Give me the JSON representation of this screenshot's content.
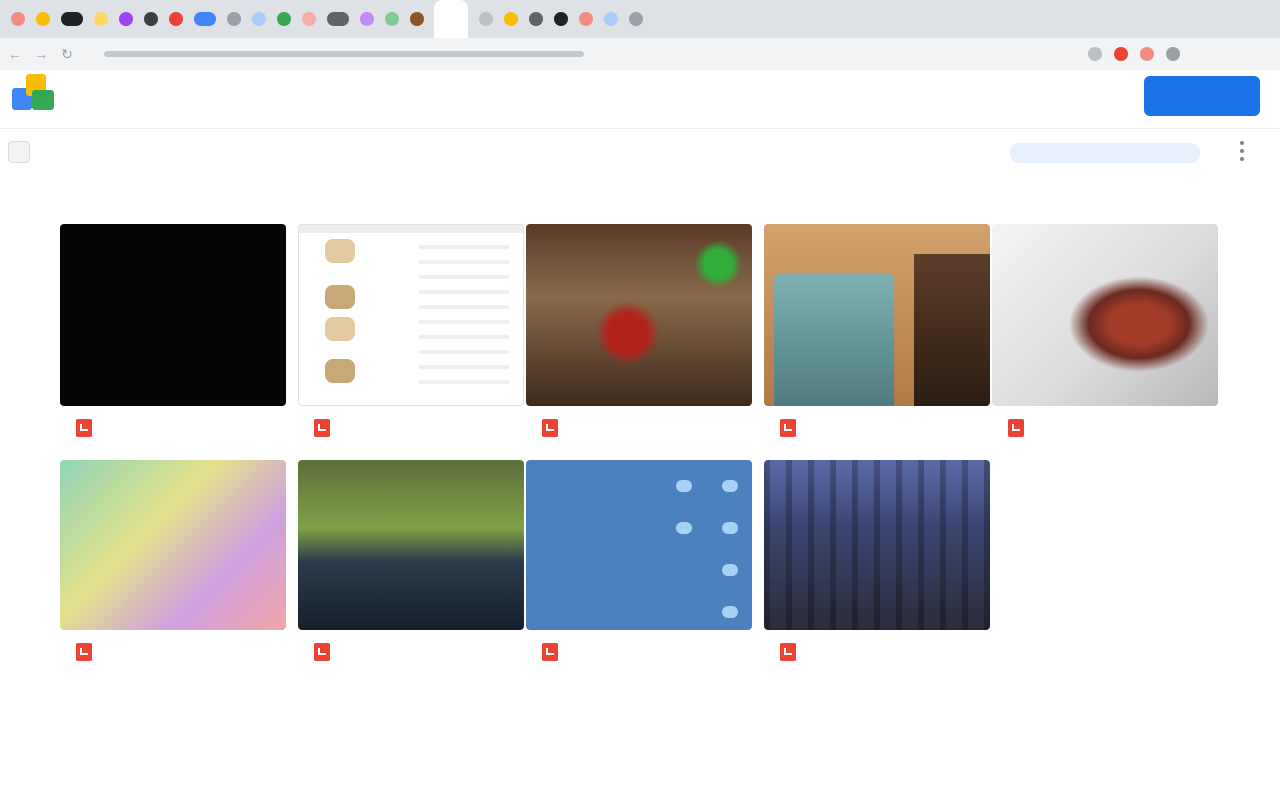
{
  "browser": {
    "tab_favicons": [
      "#f28b82",
      "#fbbc04",
      "#202124",
      "#fdd663",
      "#a142f4",
      "#3c4043",
      "#ea4335",
      "#4285f4",
      "#9aa0a6",
      "#aecbfa",
      "#34a853",
      "#f6aea9",
      "#5f6368",
      "#c58af9",
      "#81c995",
      "#8d5524"
    ],
    "tab_favicons_right": [
      "#bdc1c6",
      "#fbbc04",
      "#5f6368",
      "#202124",
      "#f28b82",
      "#aecbfa",
      "#9aa0a6"
    ],
    "extension_colors": [
      "#bdc1c6",
      "#ea4335",
      "#f28b82",
      "#9aa0a6"
    ]
  },
  "header": {
    "brand_label": "",
    "help_label": "",
    "primary_button_label": ""
  },
  "subbar": {
    "select_label": "",
    "search_placeholder": ""
  },
  "content": {
    "section_label": "",
    "sort_label": "",
    "files": [
      {
        "name": "",
        "thumb": "black"
      },
      {
        "name": "",
        "thumb": "document"
      },
      {
        "name": "",
        "thumb": "restaurant"
      },
      {
        "name": "",
        "thumb": "building"
      },
      {
        "name": "",
        "thumb": "food"
      },
      {
        "name": "",
        "thumb": "gradient"
      },
      {
        "name": "",
        "thumb": "dashboard"
      },
      {
        "name": "",
        "thumb": "blue-screen"
      },
      {
        "name": "",
        "thumb": "city"
      }
    ]
  },
  "colors": {
    "accent": "#1a73e8",
    "file_icon": "#ea4335"
  }
}
